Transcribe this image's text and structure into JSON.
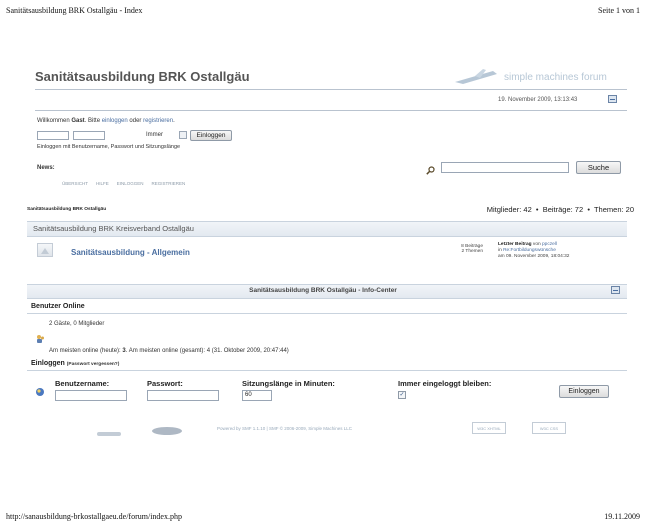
{
  "print_header": {
    "left": "Sanitätsausbildung BRK Ostallgäu - Index",
    "right": "Seite 1 von 1"
  },
  "print_footer": {
    "left": "http://sanausbildung-brkostallgaeu.de/forum/index.php",
    "right": "19.11.2009"
  },
  "forum": {
    "title": "Sanitätsausbildung BRK Ostallgäu",
    "logo_text": "simple machines forum",
    "datetime": "19. November 2009, 13:13:43"
  },
  "welcome": {
    "prefix": "Willkommen ",
    "guest": "Gast",
    "mid": ". Bitte ",
    "login_link": "einloggen",
    "or": " oder ",
    "register_link": "registrieren",
    "end": ".",
    "duration_option": "Immer",
    "login_button": "Einloggen",
    "hint": "Einloggen mit Benutzername, Passwort und Sitzungslänge"
  },
  "news": {
    "label": "News:",
    "search_button": "Suche",
    "search_value": ""
  },
  "menu": [
    "ÜBERSICHT",
    "HILFE",
    "EINLOGGEN",
    "REGISTRIEREN"
  ],
  "board_info": {
    "breadcrumb": "Sanitätsausbildung BRK Ostallgäu",
    "stats": "Mitglieder: 42  •  Beiträge: 72  •  Themen: 20"
  },
  "category": {
    "title": "Sanitätsausbildung BRK Kreisverband Ostallgäu"
  },
  "board": {
    "name": "Sanitätsausbildung - Allgemein",
    "posts": "8 Beiträge",
    "topics": "2 Themen",
    "last_post_label": "Letzter Beitrag",
    "last_post_by": " von ",
    "last_post_user": "ppczell",
    "last_post_in": "in ",
    "last_post_topic": "Re:Fortbildungswünsche",
    "last_post_date": "am 09. November 2009, 18:04:32"
  },
  "info_center": {
    "title": "Sanitätsausbildung BRK Ostallgäu - Info-Center",
    "users_online_heading": "Benutzer Online",
    "guests_members": "2 Gäste, 0 Mitglieder",
    "most_online": {
      "prefix": "Am meisten online (heute): ",
      "today": "3",
      "middle": ". Am meisten online (gesamt): 4 (31. Oktober 2009, 20:47:44)"
    },
    "login_heading": "Einloggen",
    "forgot_password": "(Passwort vergessen?)",
    "username_label": "Benutzername:",
    "password_label": "Passwort:",
    "session_label": "Sitzungslänge in Minuten:",
    "session_value": "60",
    "always_label": "Immer eingeloggt bleiben:",
    "login_button": "Einloggen"
  },
  "footer": {
    "powered": "Powered by SMF 1.1.10 | SMF © 2006-2009, Simple Machines LLC",
    "badges": [
      "W3C XHTML",
      "W3C CSS"
    ]
  },
  "colors": {
    "accent": "#4a6ea0",
    "header_bar": "#e3e9f0",
    "title": "#555555"
  }
}
